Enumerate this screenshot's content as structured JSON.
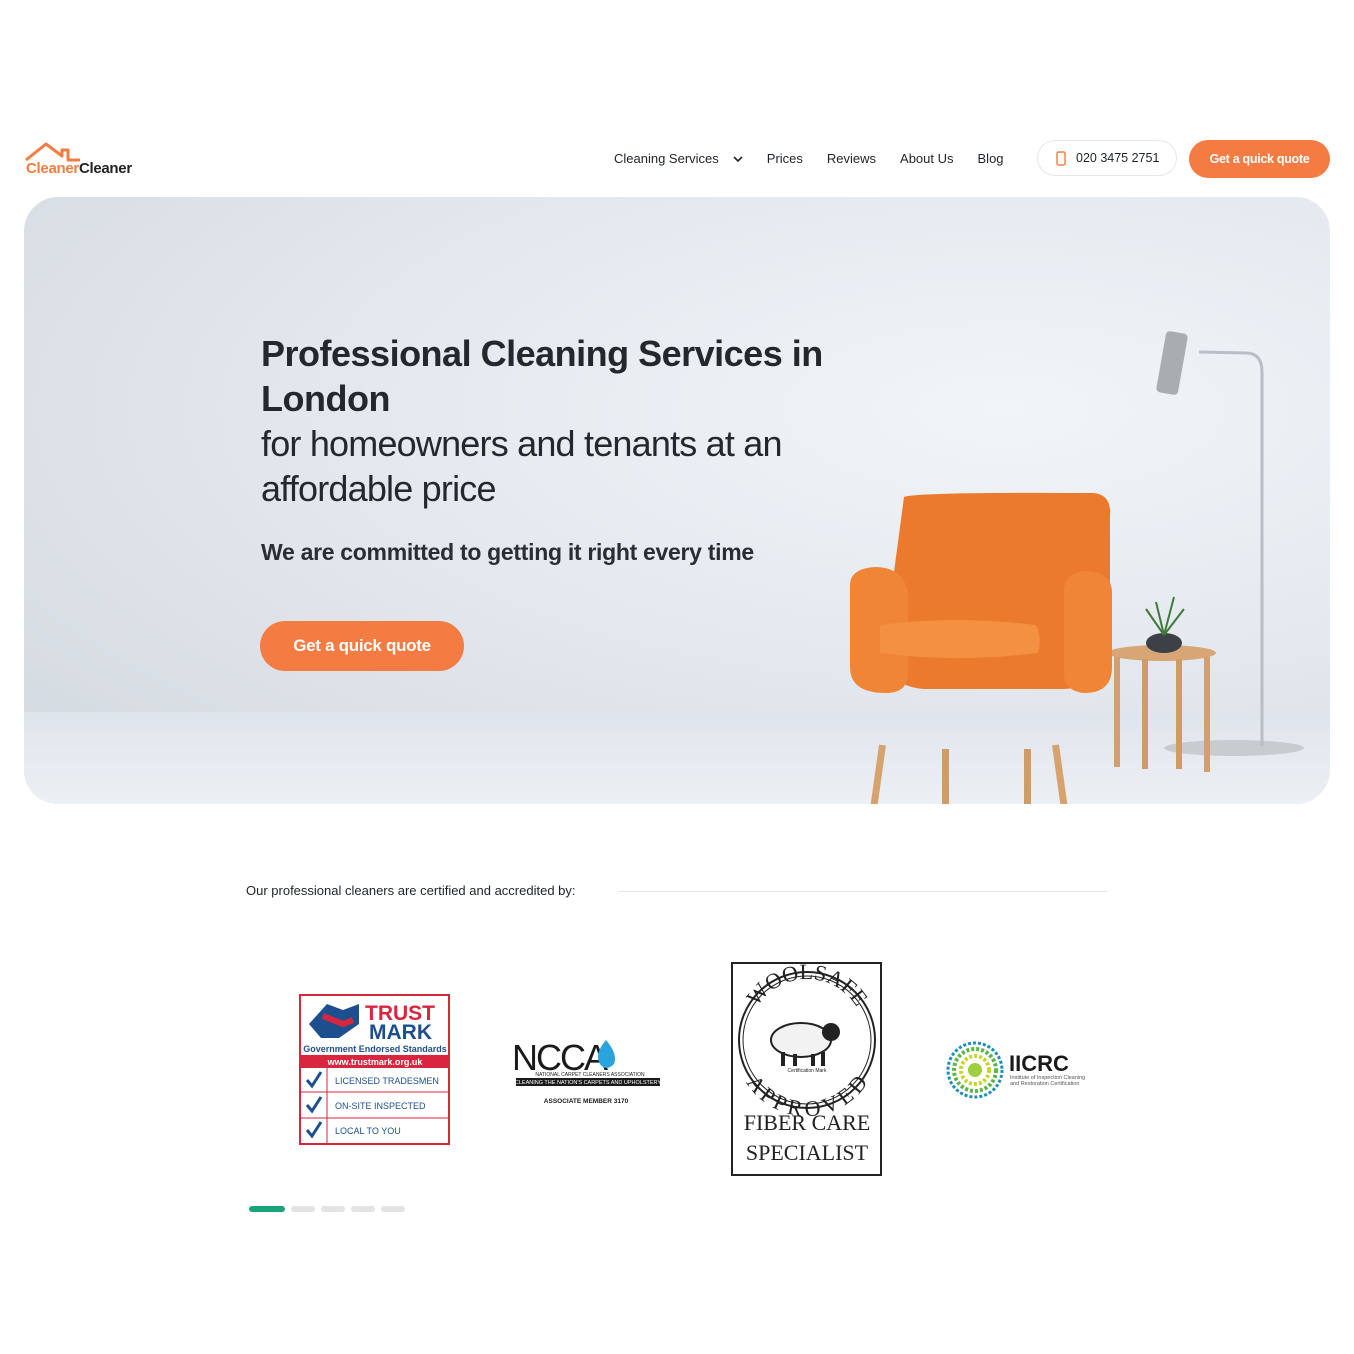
{
  "brand": {
    "name_part1": "Cleaner",
    "name_part2": "Cleaner",
    "accent": "#f47b42"
  },
  "nav": {
    "items": [
      {
        "label": "Cleaning Services",
        "has_dropdown": true
      },
      {
        "label": "Prices"
      },
      {
        "label": "Reviews"
      },
      {
        "label": "About Us"
      },
      {
        "label": "Blog"
      }
    ],
    "phone": "020 3475 2751",
    "cta": "Get a quick quote"
  },
  "hero": {
    "title": "Professional Cleaning Services in London",
    "subtitle": "for homeowners and tenants at an affordable price",
    "tagline": "We are committed to getting it right every time",
    "cta": "Get a quick quote"
  },
  "accreditation": {
    "label": "Our professional cleaners are certified and accredited by:",
    "trustmark": {
      "title1": "TRUST",
      "title2": "MARK",
      "subtitle": "Government Endorsed Standards",
      "url": "www.trustmark.org.uk",
      "items": [
        "LICENSED TRADESMEN",
        "ON-SITE INSPECTED",
        "LOCAL TO YOU"
      ]
    },
    "ncca": {
      "logo": "NCCA",
      "line1": "NATIONAL CARPET CLEANERS ASSOCIATION",
      "line2": "CLEANING THE NATION'S CARPETS AND UPHOLSTERY",
      "member": "ASSOCIATE MEMBER 3170"
    },
    "woolsafe": {
      "top": "WOOLSAFE",
      "bottom": "APPROVED",
      "mark": "Certification Mark",
      "line1": "FIBER CARE",
      "line2": "SPECIALIST"
    },
    "iicrc": {
      "name": "IICRC",
      "line1": "Institute of Inspection Cleaning",
      "line2": "and Restoration Certification"
    }
  },
  "carousel": {
    "pages": 5,
    "active": 0,
    "active_color": "#1aa37a"
  }
}
